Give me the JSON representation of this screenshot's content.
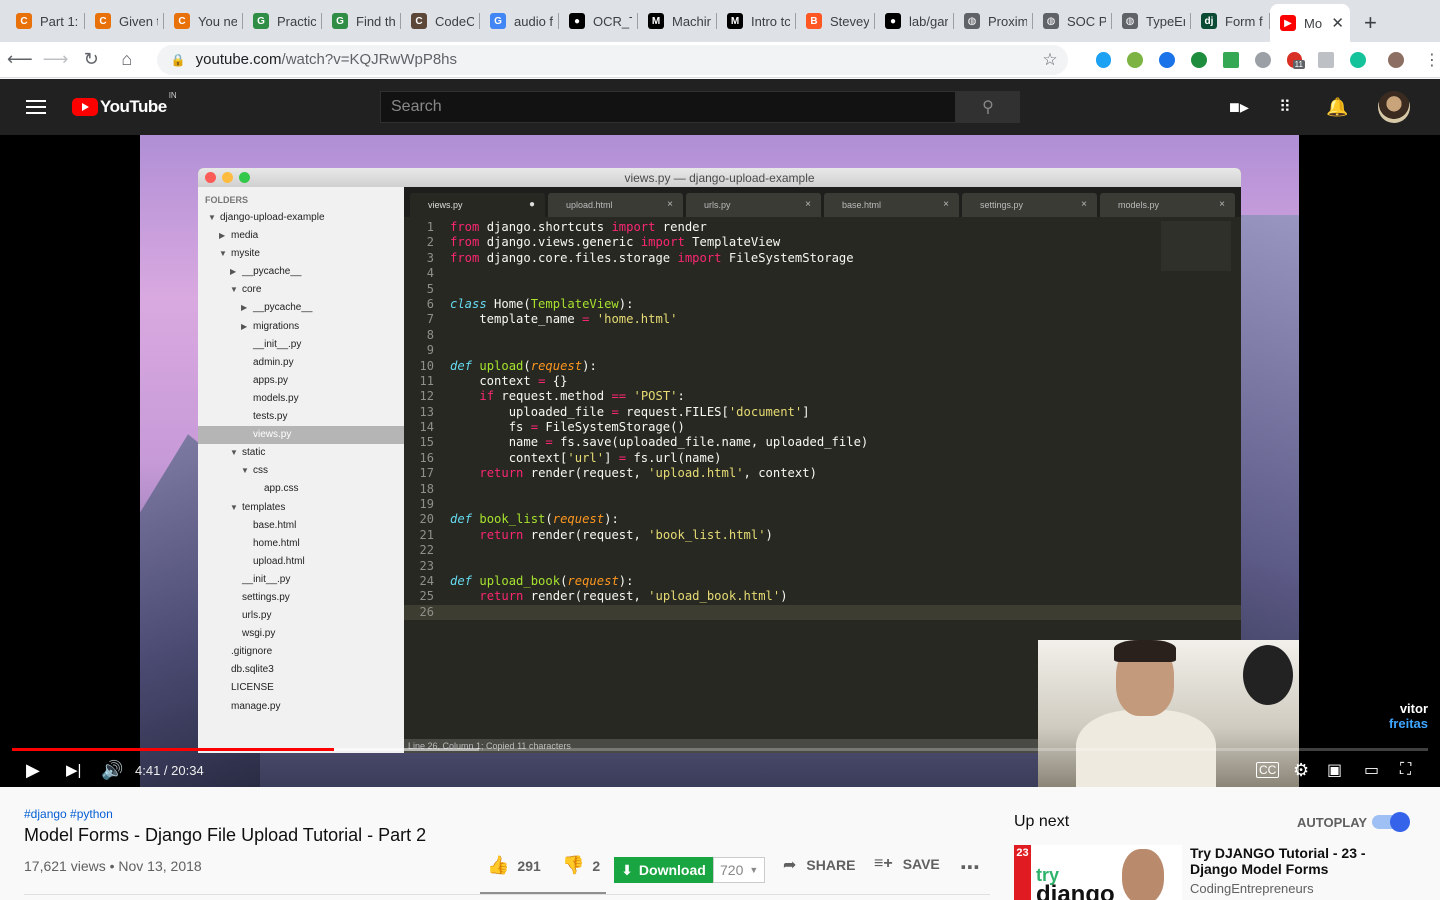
{
  "browser": {
    "tabs": [
      {
        "label": "Part 1:",
        "icon": "circle-c-icon",
        "color": "#e8710a"
      },
      {
        "label": "Given t",
        "icon": "circle-c-icon",
        "color": "#e8710a"
      },
      {
        "label": "You ne",
        "icon": "circle-c-icon",
        "color": "#e8710a"
      },
      {
        "label": "Practic",
        "icon": "gfg-icon",
        "color": "#2f8d46"
      },
      {
        "label": "Find th",
        "icon": "gfg-icon",
        "color": "#2f8d46"
      },
      {
        "label": "CodeC",
        "icon": "codechef-icon",
        "color": "#5b4638"
      },
      {
        "label": "audio f",
        "icon": "google-icon",
        "color": "#4285f4"
      },
      {
        "label": "OCR_T",
        "icon": "github-icon",
        "color": "#000000"
      },
      {
        "label": "Machir",
        "icon": "medium-icon",
        "color": "#000000"
      },
      {
        "label": "Intro tc",
        "icon": "medium-icon",
        "color": "#000000"
      },
      {
        "label": "Stevey",
        "icon": "blogger-icon",
        "color": "#ff5722"
      },
      {
        "label": "lab/gar",
        "icon": "github-icon",
        "color": "#000000"
      },
      {
        "label": "Proxim",
        "icon": "globe-icon",
        "color": "#5f6368"
      },
      {
        "label": "SOC P",
        "icon": "globe-icon",
        "color": "#5f6368"
      },
      {
        "label": "TypeEr",
        "icon": "globe-icon",
        "color": "#5f6368"
      },
      {
        "label": "Form f",
        "icon": "django-icon",
        "color": "#0c4b33"
      }
    ],
    "active_tab": {
      "label": "Mo",
      "icon": "youtube-icon",
      "color": "#ff0000"
    },
    "url_host": "youtube.com",
    "url_path": "/watch?v=KQJRwWpP8hs",
    "extension_badge": "11"
  },
  "youtube": {
    "logo": "YouTube",
    "region": "IN",
    "search_placeholder": "Search"
  },
  "video": {
    "editor_title": "views.py — django-upload-example",
    "folders_header": "FOLDERS",
    "tree": [
      {
        "label": "django-upload-example",
        "indent": 0,
        "arrow": "▼"
      },
      {
        "label": "media",
        "indent": 1,
        "arrow": "▶"
      },
      {
        "label": "mysite",
        "indent": 1,
        "arrow": "▼"
      },
      {
        "label": "__pycache__",
        "indent": 2,
        "arrow": "▶"
      },
      {
        "label": "core",
        "indent": 2,
        "arrow": "▼"
      },
      {
        "label": "__pycache__",
        "indent": 3,
        "arrow": "▶"
      },
      {
        "label": "migrations",
        "indent": 3,
        "arrow": "▶"
      },
      {
        "label": "__init__.py",
        "indent": 3,
        "arrow": ""
      },
      {
        "label": "admin.py",
        "indent": 3,
        "arrow": ""
      },
      {
        "label": "apps.py",
        "indent": 3,
        "arrow": ""
      },
      {
        "label": "models.py",
        "indent": 3,
        "arrow": ""
      },
      {
        "label": "tests.py",
        "indent": 3,
        "arrow": ""
      },
      {
        "label": "views.py",
        "indent": 3,
        "arrow": "",
        "selected": true
      },
      {
        "label": "static",
        "indent": 2,
        "arrow": "▼"
      },
      {
        "label": "css",
        "indent": 3,
        "arrow": "▼"
      },
      {
        "label": "app.css",
        "indent": 4,
        "arrow": ""
      },
      {
        "label": "templates",
        "indent": 2,
        "arrow": "▼"
      },
      {
        "label": "base.html",
        "indent": 3,
        "arrow": ""
      },
      {
        "label": "home.html",
        "indent": 3,
        "arrow": ""
      },
      {
        "label": "upload.html",
        "indent": 3,
        "arrow": ""
      },
      {
        "label": "__init__.py",
        "indent": 2,
        "arrow": ""
      },
      {
        "label": "settings.py",
        "indent": 2,
        "arrow": ""
      },
      {
        "label": "urls.py",
        "indent": 2,
        "arrow": ""
      },
      {
        "label": "wsgi.py",
        "indent": 2,
        "arrow": ""
      },
      {
        "label": ".gitignore",
        "indent": 1,
        "arrow": ""
      },
      {
        "label": "db.sqlite3",
        "indent": 1,
        "arrow": ""
      },
      {
        "label": "LICENSE",
        "indent": 1,
        "arrow": ""
      },
      {
        "label": "manage.py",
        "indent": 1,
        "arrow": ""
      }
    ],
    "editor_tabs": [
      {
        "label": "views.py",
        "active": true,
        "close": "●"
      },
      {
        "label": "upload.html",
        "active": false,
        "close": "×"
      },
      {
        "label": "urls.py",
        "active": false,
        "close": "×"
      },
      {
        "label": "base.html",
        "active": false,
        "close": "×"
      },
      {
        "label": "settings.py",
        "active": false,
        "close": "×"
      },
      {
        "label": "models.py",
        "active": false,
        "close": "×"
      }
    ],
    "code": [
      [
        [
          "kw",
          "from"
        ],
        [
          "",
          " django.shortcuts "
        ],
        [
          "kw",
          "import"
        ],
        [
          "",
          " render"
        ]
      ],
      [
        [
          "kw",
          "from"
        ],
        [
          "",
          " django.views.generic "
        ],
        [
          "kw",
          "import"
        ],
        [
          "",
          " TemplateView"
        ]
      ],
      [
        [
          "kw",
          "from"
        ],
        [
          "",
          " django.core.files.storage "
        ],
        [
          "kw",
          "import"
        ],
        [
          "",
          " FileSystemStorage"
        ]
      ],
      [],
      [],
      [
        [
          "df",
          "class"
        ],
        [
          "",
          " Home("
        ],
        [
          "fn",
          "TemplateView"
        ],
        [
          "",
          "):"
        ]
      ],
      [
        [
          "",
          "    template_name "
        ],
        [
          "kw",
          "="
        ],
        [
          "",
          " "
        ],
        [
          "st",
          "'home.html'"
        ]
      ],
      [],
      [],
      [
        [
          "df",
          "def"
        ],
        [
          "",
          " "
        ],
        [
          "fn",
          "upload"
        ],
        [
          "",
          "("
        ],
        [
          "ar",
          "request"
        ],
        [
          "",
          "):"
        ]
      ],
      [
        [
          "",
          "    context "
        ],
        [
          "kw",
          "="
        ],
        [
          "",
          " {}"
        ]
      ],
      [
        [
          "",
          "    "
        ],
        [
          "kw",
          "if"
        ],
        [
          "",
          " request.method "
        ],
        [
          "kw",
          "=="
        ],
        [
          "",
          " "
        ],
        [
          "st",
          "'POST'"
        ],
        [
          "",
          ":"
        ]
      ],
      [
        [
          "",
          "        uploaded_file "
        ],
        [
          "kw",
          "="
        ],
        [
          "",
          " request.FILES["
        ],
        [
          "st",
          "'document'"
        ],
        [
          "",
          "]"
        ]
      ],
      [
        [
          "",
          "        fs "
        ],
        [
          "kw",
          "="
        ],
        [
          "",
          " FileSystemStorage()"
        ]
      ],
      [
        [
          "",
          "        name "
        ],
        [
          "kw",
          "="
        ],
        [
          "",
          " fs.save(uploaded_file.name, uploaded_file)"
        ]
      ],
      [
        [
          "",
          "        context["
        ],
        [
          "st",
          "'url'"
        ],
        [
          "",
          "] "
        ],
        [
          "kw",
          "="
        ],
        [
          "",
          " fs.url(name)"
        ]
      ],
      [
        [
          "",
          "    "
        ],
        [
          "kw",
          "return"
        ],
        [
          "",
          " render(request, "
        ],
        [
          "st",
          "'upload.html'"
        ],
        [
          "",
          ", context)"
        ]
      ],
      [],
      [],
      [
        [
          "df",
          "def"
        ],
        [
          "",
          " "
        ],
        [
          "fn",
          "book_list"
        ],
        [
          "",
          "("
        ],
        [
          "ar",
          "request"
        ],
        [
          "",
          "):"
        ]
      ],
      [
        [
          "",
          "    "
        ],
        [
          "kw",
          "return"
        ],
        [
          "",
          " render(request, "
        ],
        [
          "st",
          "'book_list.html'"
        ],
        [
          "",
          ")"
        ]
      ],
      [],
      [],
      [
        [
          "df",
          "def"
        ],
        [
          "",
          " "
        ],
        [
          "fn",
          "upload_book"
        ],
        [
          "",
          "("
        ],
        [
          "ar",
          "request"
        ],
        [
          "",
          "):"
        ]
      ],
      [
        [
          "",
          "    "
        ],
        [
          "kw",
          "return"
        ],
        [
          "",
          " render(request, "
        ],
        [
          "st",
          "'upload_book.html'"
        ],
        [
          "",
          ")"
        ]
      ],
      []
    ],
    "status_bar": "Line 26, Column 1; Copied 11 characters",
    "watermark_line1": "vitor",
    "watermark_line2": "freitas",
    "time_display": "4:41 / 20:34",
    "played_fraction": 0.2276,
    "buffered_fraction": 0.33
  },
  "info": {
    "hashtags": "#django #python",
    "title": "Model Forms - Django File Upload Tutorial - Part 2",
    "meta": "17,621 views • Nov 13, 2018",
    "likes": "291",
    "dislikes": "2",
    "download_label": "Download",
    "quality": "720",
    "share_label": "SHARE",
    "save_label": "SAVE"
  },
  "sidebar": {
    "up_next": "Up next",
    "autoplay": "AUTOPLAY",
    "autoplay_on": true,
    "rec_title": "Try DJANGO Tutorial - 23 - Django Model Forms",
    "rec_channel": "CodingEntrepreneurs",
    "thumb_badge": "23",
    "thumb_text1": "try",
    "thumb_text2": "django"
  }
}
